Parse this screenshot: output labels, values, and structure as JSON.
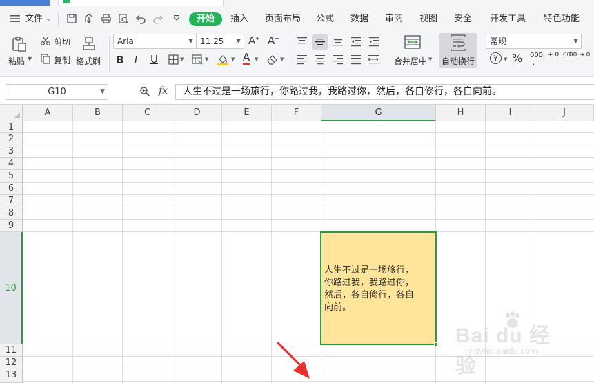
{
  "menu": {
    "file_label": "文件",
    "tabs": [
      "开始",
      "插入",
      "页面布局",
      "公式",
      "数据",
      "审阅",
      "视图",
      "安全",
      "开发工具",
      "特色功能"
    ],
    "active_tab": "开始"
  },
  "ribbon": {
    "paste_label": "粘贴",
    "cut_label": "剪切",
    "copy_label": "复制",
    "format_painter_label": "格式刷",
    "font_name": "Arial",
    "font_size": "11.25",
    "merge_center_label": "合并居中",
    "wrap_text_label": "自动换行",
    "number_format": "常规",
    "percent_symbol": "%",
    "currency_symbol": "¥",
    "thousands_symbol": "000",
    "inc_decimal": "+.0 .00",
    "dec_decimal": ".00 →.0"
  },
  "formula_bar": {
    "cell_ref": "G10",
    "fx_label": "fx",
    "content": "人生不过是一场旅行，你路过我，我路过你，然后，各自修行，各自向前。"
  },
  "grid": {
    "columns": [
      "A",
      "B",
      "C",
      "D",
      "E",
      "F",
      "G",
      "H",
      "I",
      "J"
    ],
    "rows": [
      "1",
      "2",
      "3",
      "4",
      "5",
      "6",
      "7",
      "8",
      "9",
      "10",
      "11",
      "12",
      "13"
    ],
    "selected_column": "G",
    "selected_row": "10",
    "active_cell_lines": [
      "人生不过是一场旅行，",
      "你路过我，我路过你，",
      "然后，各自修行，各自",
      "向前。"
    ]
  },
  "colors": {
    "accent_green": "#22b35b",
    "selection_green": "#2f9a43",
    "cell_fill": "#ffe59a",
    "arrow_red": "#e8302c"
  },
  "watermark": {
    "logo": "Bai du 经验",
    "site": "jingyan.baidu.com"
  }
}
